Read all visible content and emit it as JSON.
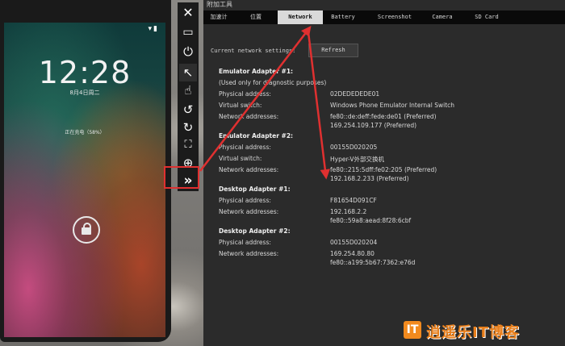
{
  "phone": {
    "status_icons": "▾▮",
    "time": "12:28",
    "date": "8月4日周二",
    "charging": "正在充电（58%）"
  },
  "toolbar": {
    "icons": [
      "close-icon",
      "minimize-icon",
      "power-icon",
      "pointer-icon",
      "touch-icon",
      "rotate-left-icon",
      "rotate-right-icon",
      "fit-screen-icon",
      "zoom-icon",
      "more-tools-icon"
    ],
    "close": "✕",
    "minimize": "▭",
    "power": "⏻",
    "pointer": "↖",
    "touch": "☝",
    "rotate_left": "↺",
    "rotate_right": "↻",
    "fit": "⛶",
    "zoom": "⊕",
    "more": "»"
  },
  "panel": {
    "title": "附加工具",
    "tabs": [
      "加速计",
      "位置",
      "Network",
      "Battery",
      "Screenshot",
      "Camera",
      "SD Card"
    ],
    "selected_tab": "Network",
    "settings_label": "Current network settings:",
    "refresh_label": "Refresh",
    "adapters": [
      {
        "name": "Emulator Adapter #1:",
        "note": "(Used only for diagnostic purposes)",
        "rows": [
          {
            "label": "Physical address:",
            "values": [
              "02DEDEDEDE01"
            ]
          },
          {
            "label": "Virtual switch:",
            "values": [
              "Windows Phone Emulator Internal Switch"
            ]
          },
          {
            "label": "Network addresses:",
            "values": [
              "fe80::de:deff:fede:de01 (Preferred)",
              "169.254.109.177 (Preferred)"
            ]
          }
        ]
      },
      {
        "name": "Emulator Adapter #2:",
        "rows": [
          {
            "label": "Physical address:",
            "values": [
              "00155D020205"
            ]
          },
          {
            "label": "Virtual switch:",
            "values": [
              "Hyper-V外部交换机"
            ]
          },
          {
            "label": "Network addresses:",
            "values": [
              "fe80::215:5dff:fe02:205 (Preferred)",
              "192.168.2.233 (Preferred)"
            ]
          }
        ]
      },
      {
        "name": "Desktop Adapter #1:",
        "rows": [
          {
            "label": "Physical address:",
            "values": [
              "F81654D091CF"
            ]
          },
          {
            "label": "Network addresses:",
            "values": [
              "192.168.2.2",
              "fe80::59a8:aead:8f28:6cbf"
            ]
          }
        ]
      },
      {
        "name": "Desktop Adapter #2:",
        "rows": [
          {
            "label": "Physical address:",
            "values": [
              "00155D020204"
            ]
          },
          {
            "label": "Network addresses:",
            "values": [
              "169.254.80.80",
              "fe80::a199:5b67:7362:e76d"
            ]
          }
        ]
      }
    ]
  },
  "watermark": {
    "logo": "IT",
    "text": "逍遥乐IT博客"
  },
  "colors": {
    "annotation_red": "#e03030",
    "panel_bg": "#2b2b2b",
    "tab_bar_bg": "#0a0a0a",
    "selected_tab_bg": "#d9d9d9",
    "watermark_orange": "#e87f1c"
  }
}
